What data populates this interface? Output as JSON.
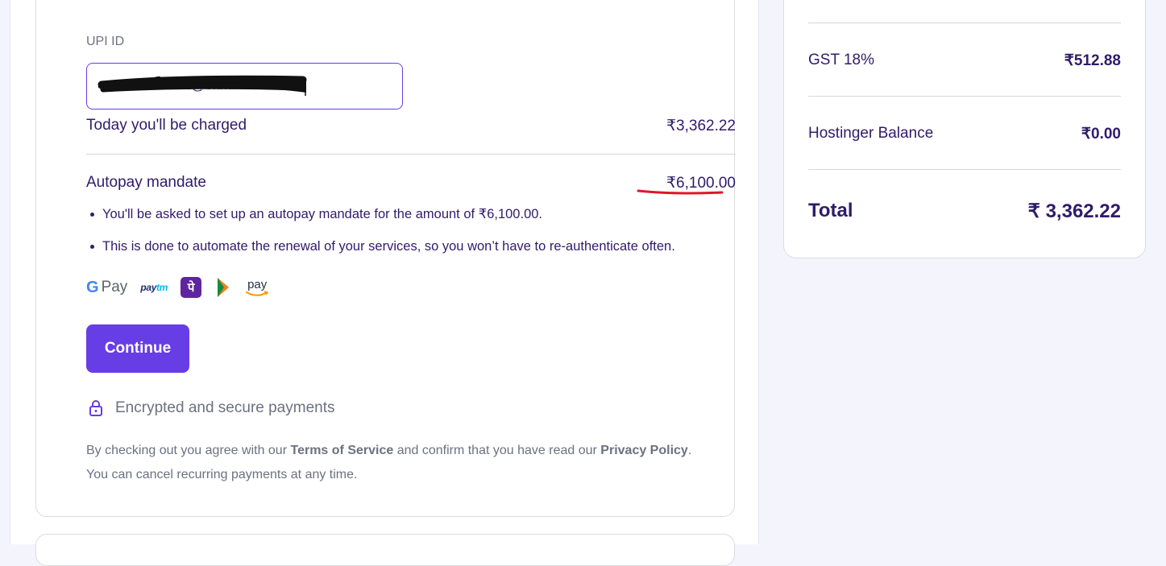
{
  "payment": {
    "upi_label": "UPI ID",
    "upi_value": "umaDsha.u071@okhdfcbank",
    "charged_label": "Today you'll be charged",
    "charged_amount": "₹3,362.22",
    "mandate_label": "Autopay mandate",
    "mandate_amount": "₹6,100.00",
    "bullets": [
      "You'll be asked to set up an autopay mandate for the amount of ₹6,100.00.",
      "This is done to automate the renewal of your services, so you won’t have to re-authenticate often."
    ],
    "logos": {
      "gpay": "Pay",
      "paytm_a": "pay",
      "paytm_b": "tm",
      "phonepe": "पे",
      "amazon_pay": "pay"
    },
    "continue_label": "Continue",
    "secure_text": "Encrypted and secure payments",
    "terms": {
      "part1": "By checking out you agree with our ",
      "tos": "Terms of Service",
      "part2": " and confirm that you have read our ",
      "privacy": "Privacy Policy",
      "part3": ". You can cancel recurring payments at any time."
    }
  },
  "summary": {
    "gst_label": "GST 18%",
    "gst_value": "₹512.88",
    "balance_label": "Hostinger Balance",
    "balance_value": "₹0.00",
    "total_label": "Total",
    "total_value": "₹ 3,362.22"
  },
  "colors": {
    "accent": "#673de6",
    "text": "#2f1c6a",
    "muted": "#6d7081",
    "annotation": "#e0162b"
  }
}
